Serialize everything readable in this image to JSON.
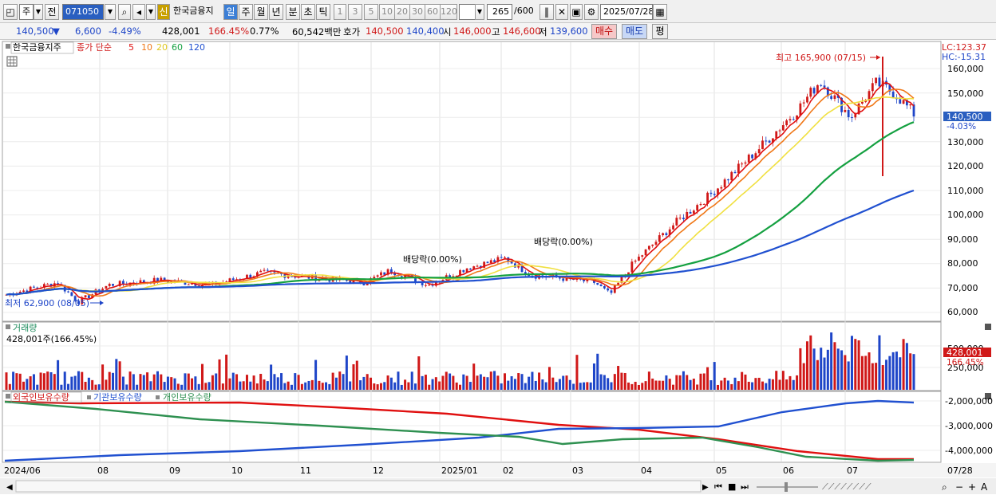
{
  "toolbar": {
    "market": "주",
    "period_prefix": "전",
    "code": "071050",
    "stock_name": "한국금융지",
    "badge": "신",
    "periods": [
      "일",
      "주",
      "월",
      "년",
      "분",
      "초",
      "틱"
    ],
    "intervals": [
      "1",
      "3",
      "5",
      "10",
      "20",
      "30",
      "60",
      "120"
    ],
    "count_current": "265",
    "count_total": "/600",
    "date": "2025/07/28"
  },
  "quote": {
    "price": "140,500",
    "arrow": "▼",
    "change": "6,600",
    "change_pct": "-4.49%",
    "volume": "428,001",
    "volume_ratio": "166.45%",
    "turnover": "0.77%",
    "amount": "60,542백만",
    "bid_label": "호가",
    "ask": "140,500",
    "bid": "140,400",
    "open_label": "시",
    "open": "146,000",
    "high_label": "고",
    "high": "146,600",
    "low_label": "저",
    "low": "139,600",
    "buy_button": "매수",
    "sell_button": "매도",
    "eval_button": "평"
  },
  "price_panel": {
    "title": "한국금융지주",
    "legend_prefix": "종가 단순",
    "ma_labels": [
      "5",
      "10",
      "20",
      "60",
      "120"
    ],
    "lc": "LC:123.37",
    "hc": "HC:-15.31",
    "high_annotation": "최고 165,900 (07/15)",
    "low_annotation": "최저 62,900 (08/05)",
    "dividend_labels": [
      "배당락(0.00%)",
      "배당락(0.00%)"
    ],
    "current_price_tag": "140,500",
    "current_pct_tag": "-4.03%",
    "y_ticks": [
      "160,000",
      "150,000",
      "140,000",
      "130,000",
      "120,000",
      "110,000",
      "100,000",
      "90,000",
      "80,000",
      "70,000",
      "60,000"
    ]
  },
  "volume_panel": {
    "title": "거래량",
    "subtitle": "428,001주(166.45%)",
    "y_ticks": [
      "500,000",
      "250,000"
    ],
    "current_tag": "428,001",
    "current_pct": "166.45%"
  },
  "holdings_panel": {
    "labels": [
      "외국인보유수량",
      "기관보유수량",
      "개인보유수량"
    ],
    "y_ticks": [
      "-2,000,000",
      "-3,000,000",
      "-4,000,000"
    ]
  },
  "x_axis": [
    "2024/06",
    "08",
    "09",
    "10",
    "11",
    "12",
    "2025/01",
    "02",
    "03",
    "04",
    "05",
    "06",
    "07"
  ],
  "x_axis_right": "07/28",
  "colors": {
    "up": "#d01818",
    "down": "#1e45c8",
    "ma5": "#e01010",
    "ma10": "#f07818",
    "ma20": "#f0e040",
    "ma60": "#14a040",
    "ma120": "#2050d0",
    "foreign": "#e01010",
    "institution": "#2050d0",
    "individual": "#2e9050"
  }
}
